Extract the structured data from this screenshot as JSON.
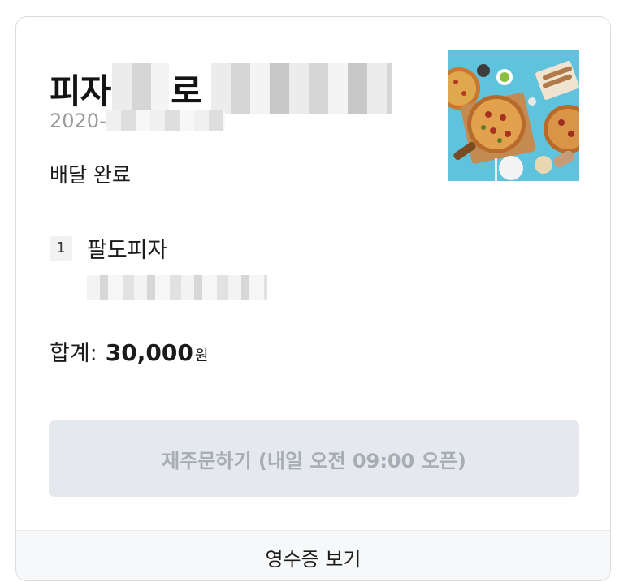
{
  "order": {
    "store_name_prefix": "피자",
    "store_name_suffix": "로",
    "date_prefix": "2020-",
    "status": "배달 완료",
    "thumbnail_icon": "pizza-photo"
  },
  "items": [
    {
      "qty": "1",
      "name": "팔도피자"
    }
  ],
  "total": {
    "label": "합계:",
    "amount": "30,000",
    "unit": "원"
  },
  "actions": {
    "reorder_label": "재주문하기 (내일 오전 09:00 오픈)",
    "receipt_label": "영수증 보기"
  },
  "colors": {
    "button_bg": "#e5e8ec",
    "button_text": "#a6adb5",
    "date_text": "#9a9a9a"
  }
}
